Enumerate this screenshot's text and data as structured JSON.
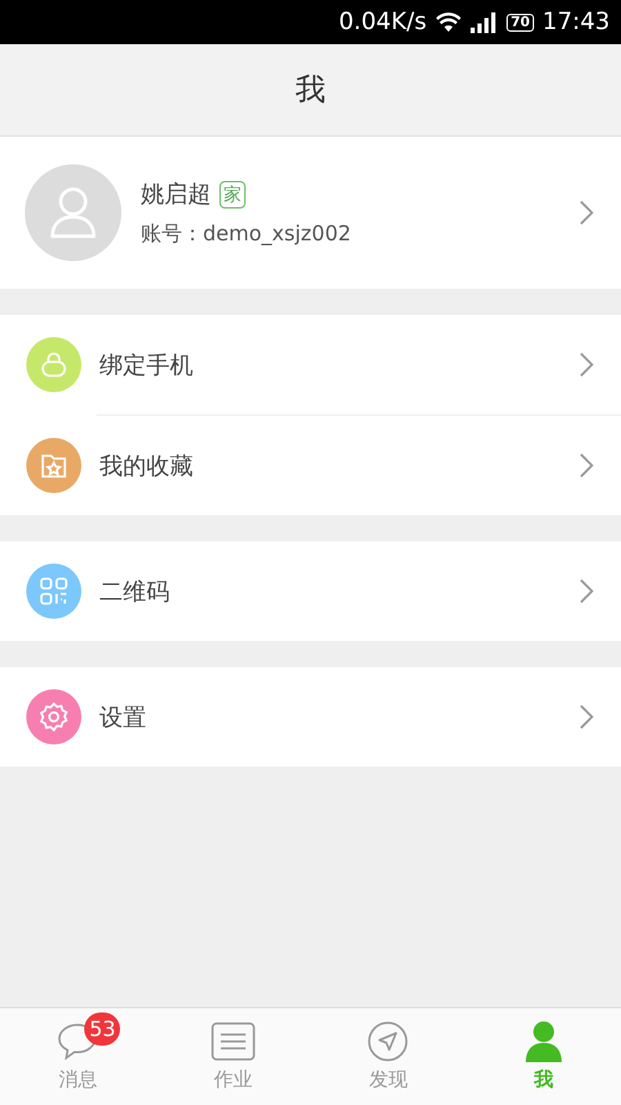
{
  "status_bar": {
    "speed": "0.04K/s",
    "battery": "70",
    "time": "17:43"
  },
  "header": {
    "title": "我"
  },
  "profile": {
    "name": "姚启超",
    "tag": "家",
    "account": "账号：demo_xsjz002"
  },
  "groups": [
    [
      {
        "label": "绑定手机",
        "kind": "lock",
        "color": "#c6e86a"
      },
      {
        "label": "我的收藏",
        "kind": "star-folder",
        "color": "#e8a966"
      }
    ],
    [
      {
        "label": "二维码",
        "kind": "qr",
        "color": "#7cc7fb"
      }
    ],
    [
      {
        "label": "设置",
        "kind": "gear",
        "color": "#f77fb0"
      }
    ]
  ],
  "tabs": [
    {
      "label": "消息",
      "kind": "chat",
      "badge": "53",
      "selected": false
    },
    {
      "label": "作业",
      "kind": "list",
      "selected": false
    },
    {
      "label": "发现",
      "kind": "compass",
      "selected": false
    },
    {
      "label": "我",
      "kind": "person",
      "selected": true
    }
  ]
}
